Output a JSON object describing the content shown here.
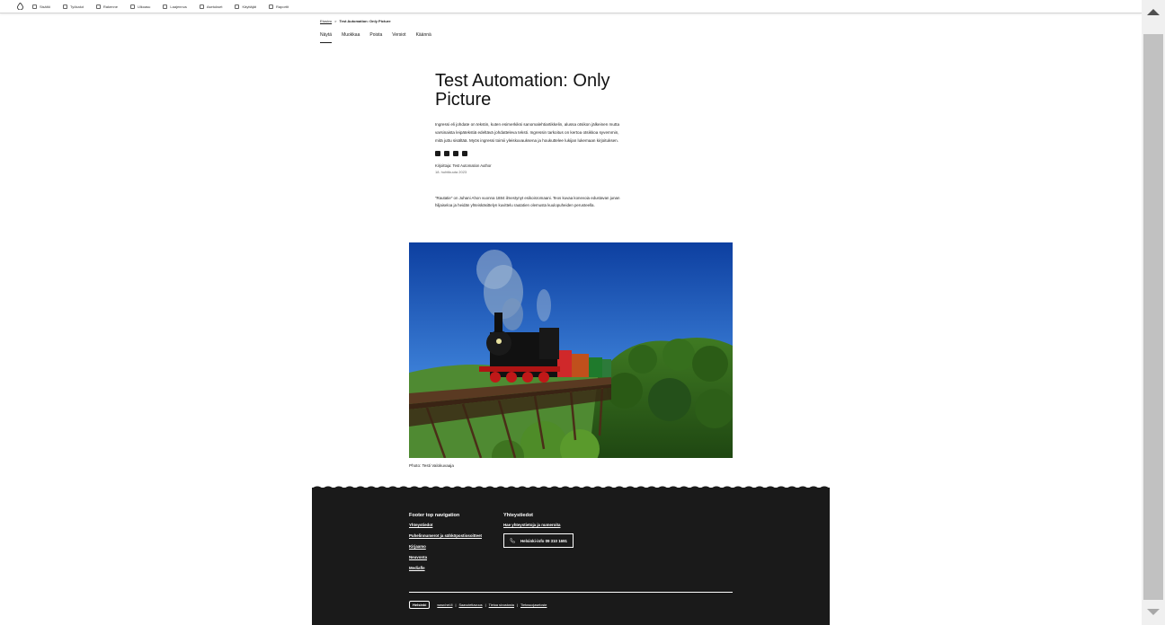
{
  "toolbar": {
    "home_icon": "drupal-drop-icon",
    "items": [
      {
        "label": "Sisältö",
        "icon": "content-icon"
      },
      {
        "label": "Työkalut",
        "icon": "tools-icon"
      },
      {
        "label": "Rakenne",
        "icon": "structure-icon"
      },
      {
        "label": "Ulkoasu",
        "icon": "appearance-icon"
      },
      {
        "label": "Laajennus",
        "icon": "extend-icon"
      },
      {
        "label": "Asetukset",
        "icon": "config-icon"
      },
      {
        "label": "Käyttäjät",
        "icon": "people-icon"
      },
      {
        "label": "Raportit",
        "icon": "reports-icon"
      }
    ]
  },
  "breadcrumb": {
    "home": "Etusivu",
    "separator": ">",
    "current": "Test Automation: Only Picture"
  },
  "tabs": [
    "Näytä",
    "Muokkaa",
    "Poista",
    "Versiot",
    "Käännä"
  ],
  "article": {
    "title": "Test Automation: Only Picture",
    "lead": "Ingressi eli johdate on tekstin, kuten esimerkiksi sanomalehtiartikkelin, alussa otsikon jälkeinen mutta varsinaista leipätekstiä edeltävä johdatteleva teksti. Ingressin tarkoitus on kertoa otsikkoa syvemmin, mitä juttu sisältää. Myös ingressi toimii yleisku­vauksena ja houkuttelee lukijan lukemaan kirjoituksen.",
    "author": "Kirjoittaja: Test Automation Author",
    "date": "18. huhtikuuta 2023",
    "body": "”Rautatie” on Juhani Ahon vuonna 1884 ilmestynyt esikoisromaani. Teos kuvaa konevoia edustavan junan hiljaiseloa ja heidän yhteiskäsittelyn kuvittelu rautatien olemusta kuulopuheiden perusteella.",
    "share_icons": [
      "facebook-icon",
      "linkedin-icon",
      "twitter-icon",
      "email-icon"
    ]
  },
  "photo": {
    "caption": "Photo: Testi Valokuvaaja",
    "subject": "steam-train-on-bridge"
  },
  "footer": {
    "nav_title": "Footer top navigation",
    "nav_links": [
      "Yhteystiedot",
      "Puhelinnumerot ja sähköpostiosoitteet",
      "Kirjaamo",
      "Neuvonta",
      "Mediafle"
    ],
    "contact_title": "Yhteystiedot",
    "contact_link": "Hae yhteystietoja ja numeroita",
    "phone": "Helsinki-info 09 310 1691",
    "logo": "Helsinki",
    "bottom_links": [
      "www.hel.fi",
      "Saavutettavuus",
      "Tietoa sivustosta",
      "Tietosuojaseloste"
    ]
  },
  "colors": {
    "footer_bg": "#1a1a1a",
    "scrollbar_thumb": "#c1c1c1"
  }
}
